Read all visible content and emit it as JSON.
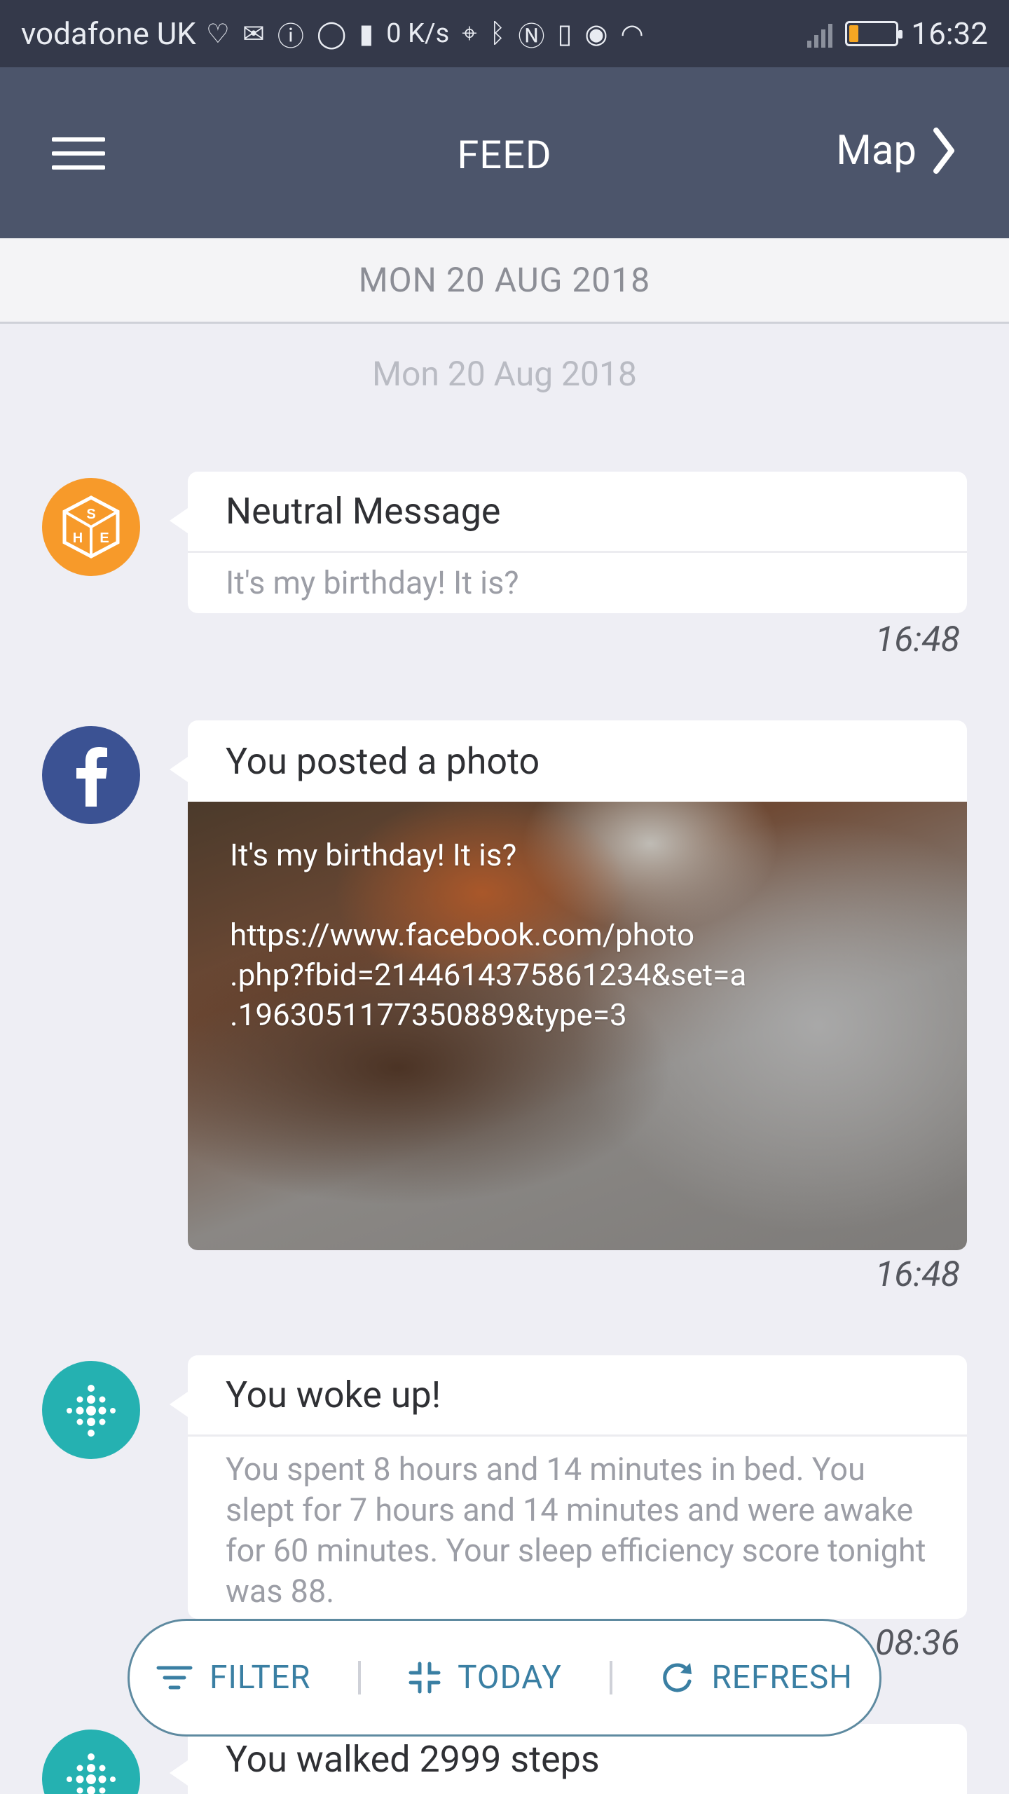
{
  "status_bar": {
    "carrier": "vodafone UK",
    "net_speed": "0 K/s",
    "time": "16:32",
    "battery_level": 0.2
  },
  "app_bar": {
    "title": "FEED",
    "map_label": "Map"
  },
  "date_header": "MON 20 AUG 2018",
  "date_sub": "Mon 20 Aug 2018",
  "feed": [
    {
      "icon": "she-logo-icon",
      "title": "Neutral Message",
      "body": "It's my birthday! It is?",
      "time": "16:48"
    },
    {
      "icon": "facebook-icon",
      "title": "You posted a photo",
      "photo_text": "It's my birthday! It is?\n\nhttps://www.facebook.com/photo\n.php?fbid=2144614375861234&set=a\n.1963051177350889&type=3",
      "time": "16:48"
    },
    {
      "icon": "fitbit-icon",
      "title": "You woke up!",
      "body": "You spent 8 hours and 14 minutes in bed. You slept for 7 hours and 14 minutes and were awake for 60 minutes. Your sleep efficiency score tonight was 88.",
      "time": "08:36"
    },
    {
      "icon": "fitbit-icon",
      "title": "You walked 2999 steps"
    }
  ],
  "actions": {
    "filter": "FILTER",
    "today": "TODAY",
    "refresh": "REFRESH"
  },
  "colors": {
    "app_bar": "#4c556b",
    "status_bar": "#34394a",
    "accent": "#3a7fa3",
    "fitbit": "#25b1b1",
    "facebook": "#3b5293",
    "orange": "#f79a2a"
  }
}
